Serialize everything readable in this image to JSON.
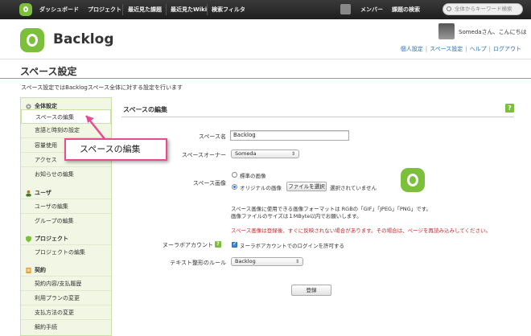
{
  "topnav": {
    "items": [
      "ダッシュボード",
      "プロジェクト",
      "最近見た課題",
      "最近見たWiki",
      "検索フィルタ"
    ],
    "right_items": [
      "メンバー",
      "課題の検索"
    ],
    "search_placeholder": "全体からキーワード検索"
  },
  "header": {
    "brand": "Backlog",
    "greeting": "Somedaさん、こんにちは",
    "links": [
      "個人設定",
      "スペース設定",
      "ヘルプ",
      "ログアウト"
    ]
  },
  "page": {
    "title": "スペース設定",
    "description": "スペース設定ではBacklogスペース全体に対する設定を行います"
  },
  "sidebar": {
    "sections": [
      {
        "title": "全体設定",
        "icon": "gear-icon",
        "items": [
          "スペースの編集",
          "言語と時刻の設定",
          "容量使用",
          "アクセス",
          "お知らせの編集"
        ]
      },
      {
        "title": "ユーザ",
        "icon": "user-icon",
        "items": [
          "ユーザの編集",
          "グループの編集"
        ]
      },
      {
        "title": "プロジェクト",
        "icon": "shield-icon",
        "items": [
          "プロジェクトの編集"
        ]
      },
      {
        "title": "契約",
        "icon": "contract-icon",
        "items": [
          "契約内容/支払履歴",
          "利用プランの変更",
          "支払方法の変更",
          "解約手続"
        ]
      }
    ]
  },
  "form": {
    "section_title": "スペースの編集",
    "help": "?",
    "space_name_label": "スペース名",
    "space_name_value": "Backlog",
    "owner_label": "スペースオーナー",
    "owner_value": "Someda",
    "image_label": "スペース画像",
    "image_option_default": "標準の画像",
    "image_option_original": "オリジナルの画像",
    "file_button": "ファイルを選択",
    "file_status": "選択されていません",
    "image_note_1": "スペース画像に使用できる画像フォーマットは RGBの「GIF」「JPEG」「PNG」です。",
    "image_note_2": "画像ファイルのサイズは１MByte以内でお願いします。",
    "image_warning": "スペース画像は登録後、すぐに反映されない場合があります。その場合は、ページを再読み込みしてください。",
    "nulab_label": "ヌーラボアカウント",
    "nulab_help": "?",
    "nulab_checkbox": "ヌーラボアカウントでのログインを許可する",
    "format_label": "テキスト整形のルール",
    "format_value": "Backlog",
    "submit": "登録"
  },
  "callout": {
    "text": "スペースの編集"
  },
  "colors": {
    "accent": "#7cbf3a",
    "callout_border": "#e84c8f",
    "warning": "#c0282d",
    "link": "#2a6fb0"
  }
}
